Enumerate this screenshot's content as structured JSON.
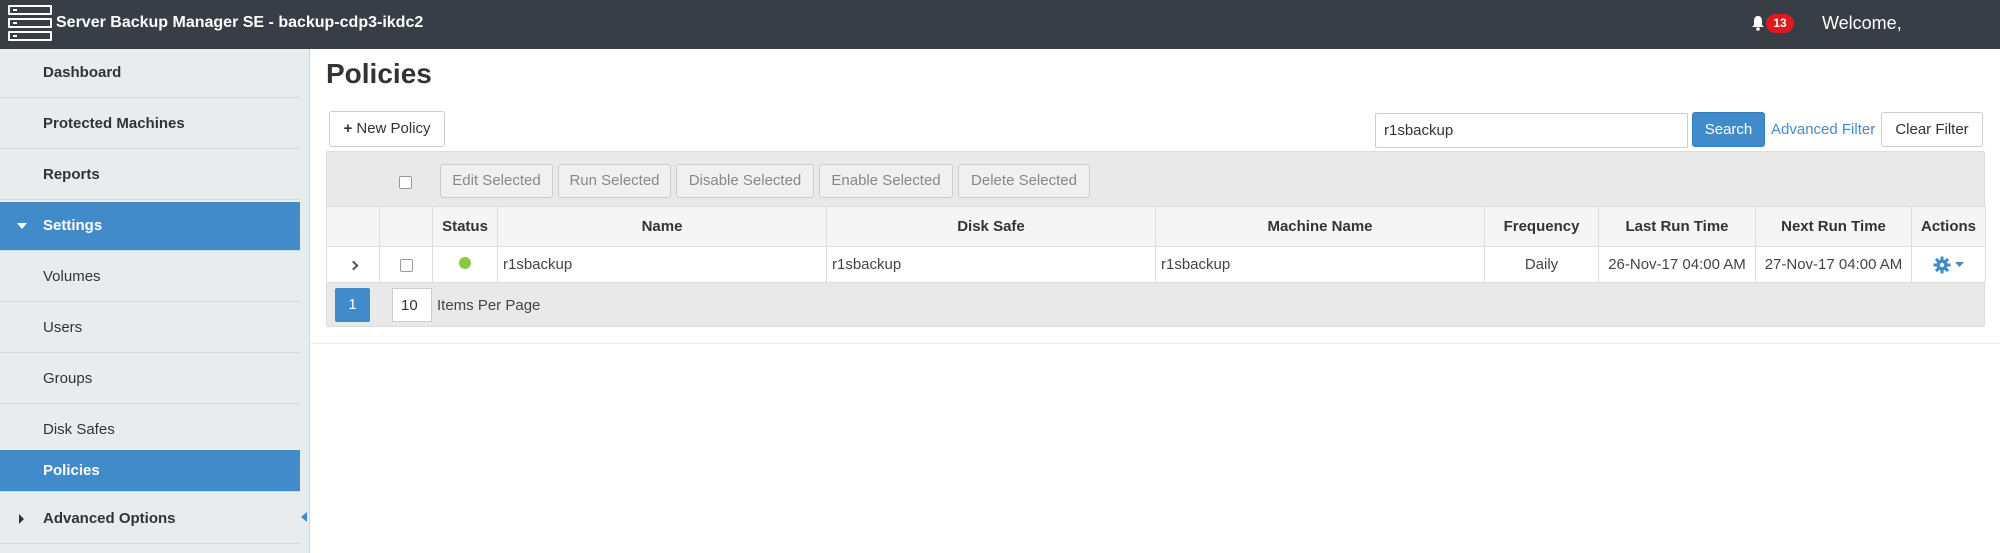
{
  "header": {
    "title": "Server Backup Manager SE - backup-cdp3-ikdc2",
    "notification_count": "13",
    "welcome": "Welcome,"
  },
  "sidebar": {
    "items": [
      {
        "label": "Dashboard"
      },
      {
        "label": "Protected Machines"
      },
      {
        "label": "Reports"
      },
      {
        "label": "Settings"
      },
      {
        "label": "Volumes"
      },
      {
        "label": "Users"
      },
      {
        "label": "Groups"
      },
      {
        "label": "Disk Safes"
      },
      {
        "label": "Policies"
      },
      {
        "label": "Advanced Options"
      }
    ]
  },
  "main": {
    "title": "Policies",
    "new_policy_label": "New Policy",
    "search_value": "r1sbackup",
    "search_label": "Search",
    "advanced_filter_label": "Advanced Filter",
    "clear_filter_label": "Clear Filter",
    "bulk_actions": {
      "edit": "Edit Selected",
      "run": "Run Selected",
      "disable": "Disable Selected",
      "enable": "Enable Selected",
      "delete": "Delete Selected"
    },
    "columns": {
      "status": "Status",
      "name": "Name",
      "disk_safe": "Disk Safe",
      "machine_name": "Machine Name",
      "frequency": "Frequency",
      "last_run": "Last Run Time",
      "next_run": "Next Run Time",
      "actions": "Actions"
    },
    "rows": [
      {
        "status": "ok",
        "name": "r1sbackup",
        "disk_safe": "r1sbackup",
        "machine_name": "r1sbackup",
        "frequency": "Daily",
        "last_run": "26-Nov-17 04:00 AM",
        "next_run": "27-Nov-17 04:00 AM"
      }
    ],
    "pager": {
      "current_page": "1",
      "items_per_page": "10",
      "items_per_page_label": "Items Per Page"
    }
  },
  "colors": {
    "accent": "#428bca",
    "topbar": "#383e45",
    "status_ok": "#8dc63f",
    "badge": "#e0191f"
  }
}
